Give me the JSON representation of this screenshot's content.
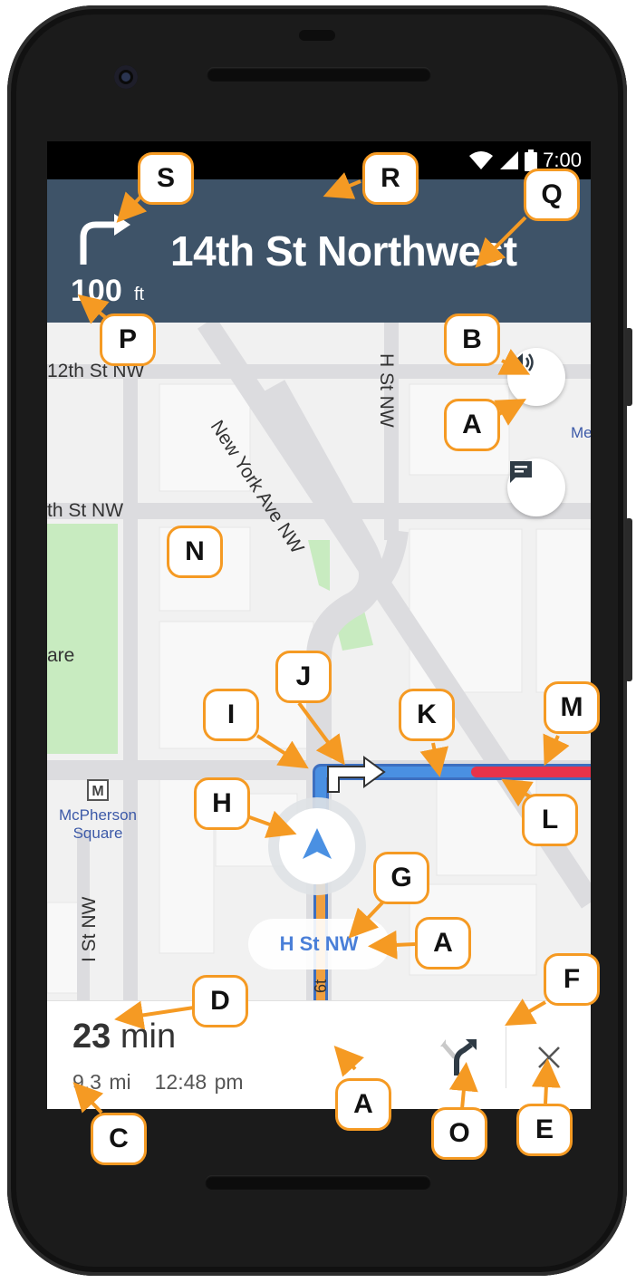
{
  "status_bar": {
    "time": "7:00",
    "wifi_icon": "wifi-icon",
    "signal_icon": "signal-icon",
    "battery_icon": "battery-icon"
  },
  "nav_header": {
    "street": "14th St Northwest",
    "distance_value": "100",
    "distance_unit": "ft",
    "maneuver_icon": "turn-right-icon",
    "background": "#3e5368"
  },
  "map": {
    "road_labels": {
      "twelfth": "12th St NW",
      "ny_ave": "New York Ave NW",
      "h_st_v": "H St NW",
      "eleventh": "th St NW",
      "are": "are",
      "i_st": "I St NW",
      "sixth": "6t",
      "me": "Me"
    },
    "metro": {
      "badge": "M",
      "name_line1": "McPherson",
      "name_line2": "Square"
    },
    "current_road": "H St NW",
    "route_color": "#4a90e2",
    "traffic_color": "#e8334a",
    "past_route_color": "#f0a040",
    "volume_icon": "volume-icon",
    "chat_icon": "chat-icon",
    "position_icon": "navigation-arrow-icon"
  },
  "footer": {
    "duration_value": "23",
    "duration_unit": "min",
    "distance": "9.3 mi",
    "arrival": "12:48 pm",
    "route_icon": "alternate-route-icon",
    "close_icon": "close-icon"
  },
  "callouts": {
    "s": "S",
    "r": "R",
    "q": "Q",
    "p": "P",
    "b": "B",
    "a1": "A",
    "n": "N",
    "j": "J",
    "i": "I",
    "k": "K",
    "m": "M",
    "h": "H",
    "l": "L",
    "g": "G",
    "a2": "A",
    "f": "F",
    "d": "D",
    "a3": "A",
    "c": "C",
    "o": "O",
    "e": "E"
  },
  "callout_color": "#f59a23"
}
